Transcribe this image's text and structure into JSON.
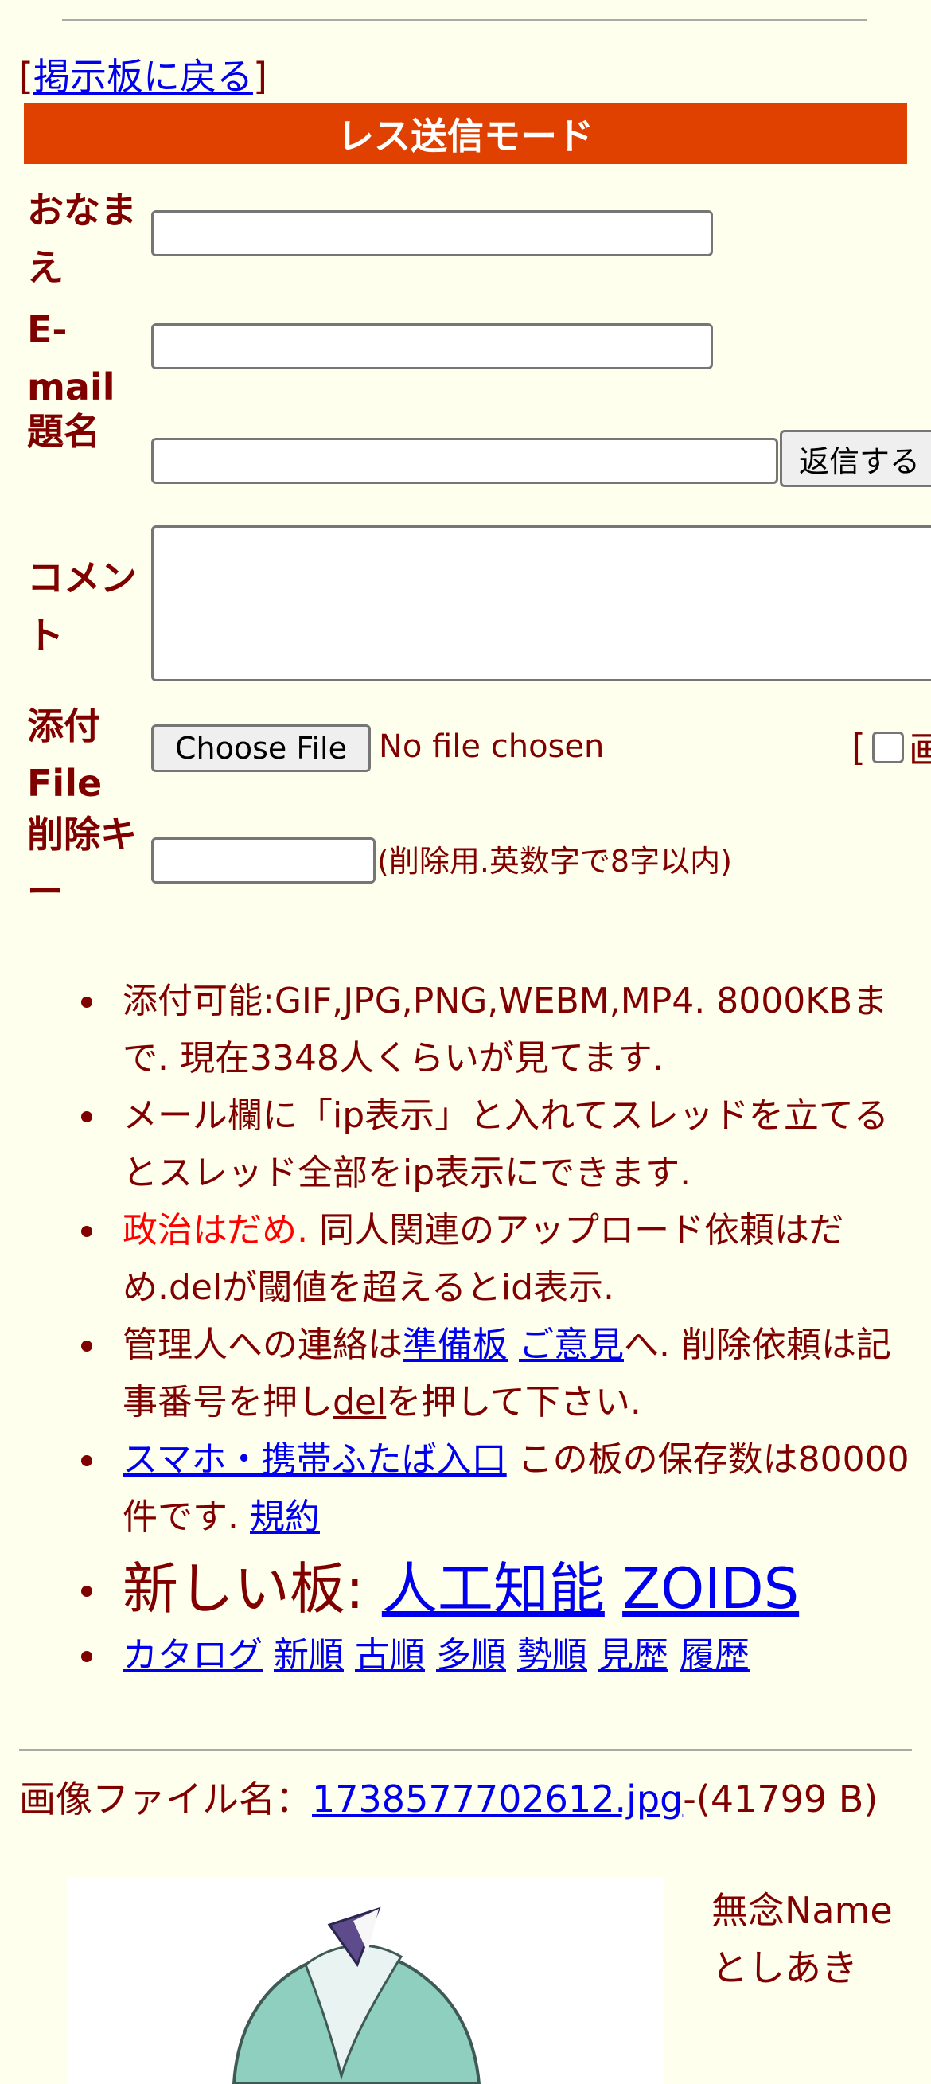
{
  "nav": {
    "bracket_open": "[",
    "back_link": "掲示板に戻る",
    "bracket_close": "]"
  },
  "banner": "レス送信モード",
  "form": {
    "name_label": "おなまえ",
    "email_label": "E-mail",
    "subject_label": "題名",
    "submit_label": "返信する",
    "comment_label": "コメント",
    "file_label": "添付File",
    "choose_file_label": "Choose File",
    "no_file_text": "No file chosen",
    "image_only_prefix": "[",
    "image_only_label": "画",
    "delkey_label": "削除キー",
    "delkey_note": "(削除用.英数字で8字以内)"
  },
  "notes": {
    "n1": "添付可能:GIF,JPG,PNG,WEBM,MP4. 8000KBまで. 現在3348人くらいが見てます.",
    "n2": "メール欄に「ip表示」と入れてスレッドを立てるとスレッド全部をip表示にできます.",
    "n3_red": "政治はだめ.",
    "n3_rest": " 同人関連のアップロード依頼はだめ.delが閾値を超えるとid表示.",
    "n4_a": "管理人への連絡は",
    "n4_link1": "準備板",
    "n4_link2": "ご意見",
    "n4_b": "へ. 削除依頼は記事番号を押し",
    "n4_link3": "del",
    "n4_c": "を押して下さい.",
    "n5_link": "スマホ・携帯ふたば入口",
    "n5_text": " この板の保存数は80000件です. ",
    "n5_link2": "規約",
    "n6_text": "新しい板: ",
    "n6_link1": "人工知能",
    "n6_link2": "ZOIDS",
    "n7_links": [
      "カタログ",
      "新順",
      "古順",
      "多順",
      "勢順",
      "見歴",
      "履歴"
    ]
  },
  "post": {
    "image_label": "画像ファイル名：",
    "file_link": "1738577702612.jpg",
    "file_size": "-(41799 B)",
    "subject": "無念",
    "name_word": "Name",
    "name": "としあき"
  },
  "colors": {
    "background": "#ffffee",
    "text": "#800000",
    "banner": "#e04000",
    "link": "#0000ee",
    "warning": "#ff0000"
  }
}
